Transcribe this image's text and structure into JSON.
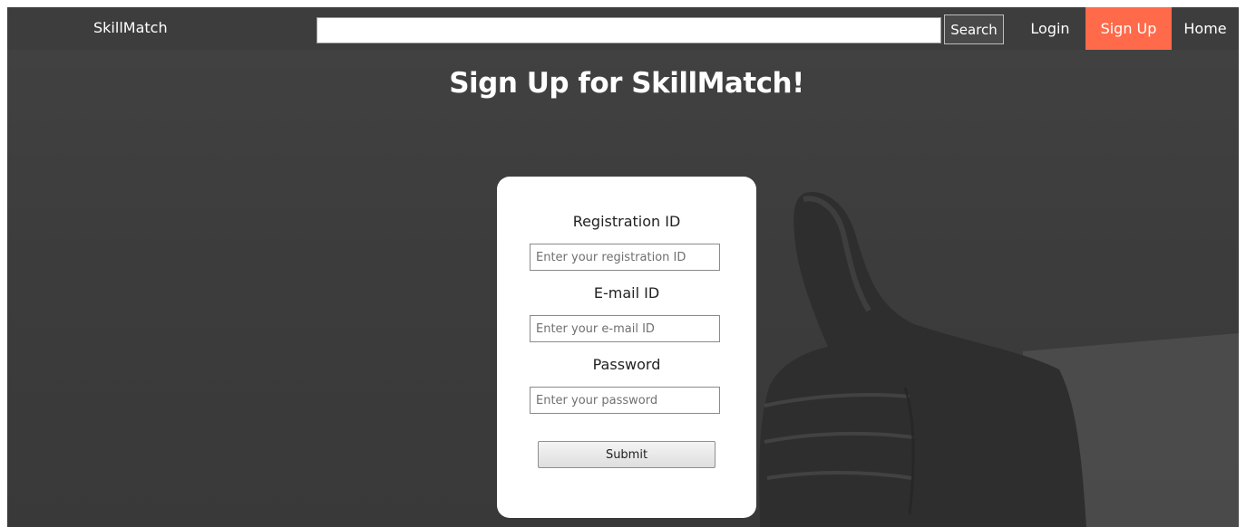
{
  "navbar": {
    "brand": "SkillMatch",
    "search": {
      "value": "",
      "placeholder": ""
    },
    "search_button": "Search",
    "links": {
      "login": "Login",
      "signup": "Sign Up",
      "home": "Home"
    },
    "active_link_color": "#ff6a4a"
  },
  "main": {
    "title": "Sign Up for SkillMatch!",
    "form": {
      "registration": {
        "label": "Registration ID",
        "placeholder": "Enter your registration ID"
      },
      "email": {
        "label": "E-mail ID",
        "placeholder": "Enter your e-mail ID"
      },
      "password": {
        "label": "Password",
        "placeholder": "Enter your password"
      },
      "submit": "Submit"
    }
  },
  "background": {
    "image": "thumbs-up-hand-photo"
  }
}
